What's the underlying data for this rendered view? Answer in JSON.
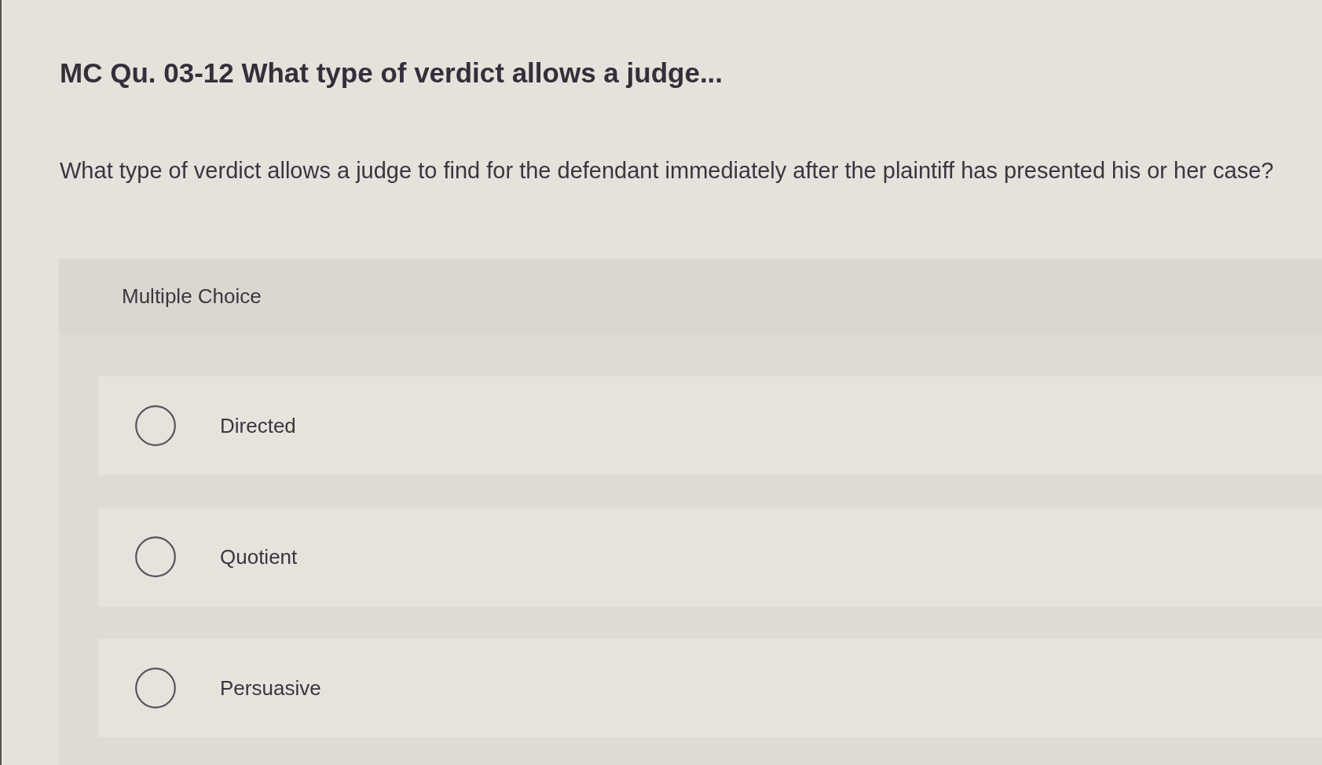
{
  "title": "MC Qu. 03-12 What type of verdict allows a judge...",
  "question": "What type of verdict allows a judge to find for the defendant immediately after the plaintiff has presented his or her case?",
  "choices": {
    "heading": "Multiple Choice",
    "options": [
      {
        "label": "Directed",
        "selected": false
      },
      {
        "label": "Quotient",
        "selected": false
      },
      {
        "label": "Persuasive",
        "selected": false
      }
    ]
  }
}
